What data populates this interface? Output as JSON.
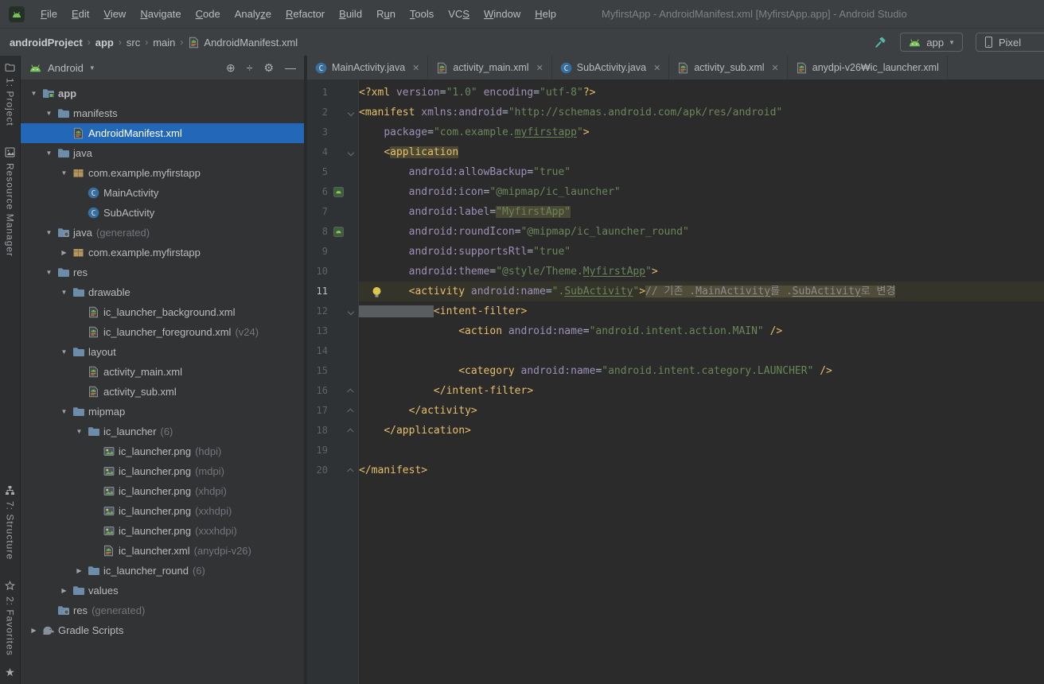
{
  "window": {
    "title": "MyfirstApp - AndroidManifest.xml [MyfirstApp.app] - Android Studio"
  },
  "menu": {
    "items": [
      {
        "label": "File",
        "m": 0
      },
      {
        "label": "Edit",
        "m": 0
      },
      {
        "label": "View",
        "m": 0
      },
      {
        "label": "Navigate",
        "m": 0
      },
      {
        "label": "Code",
        "m": 0
      },
      {
        "label": "Analyze",
        "m": 5
      },
      {
        "label": "Refactor",
        "m": 0
      },
      {
        "label": "Build",
        "m": 0
      },
      {
        "label": "Run",
        "m": 1
      },
      {
        "label": "Tools",
        "m": 0
      },
      {
        "label": "VCS",
        "m": 2
      },
      {
        "label": "Window",
        "m": 0
      },
      {
        "label": "Help",
        "m": 0
      }
    ]
  },
  "breadcrumbs": {
    "items": [
      {
        "label": "androidProject",
        "bold": true
      },
      {
        "label": "app",
        "bold": true
      },
      {
        "label": "src"
      },
      {
        "label": "main"
      },
      {
        "label": "AndroidManifest.xml",
        "icon": "android-xml"
      }
    ],
    "actions": {
      "build_icon": "hammer-icon",
      "run_config": {
        "icon": "android-head-icon",
        "label": "app"
      },
      "device": {
        "icon": "device-icon",
        "label": "Pixel"
      }
    }
  },
  "tool_stripe": {
    "top": [
      {
        "label": "1: Project",
        "icon": "project-tool-icon"
      },
      {
        "label": "Resource Manager",
        "icon": "resource-manager-icon"
      }
    ],
    "bottom": [
      {
        "label": "7: Structure",
        "icon": "structure-tool-icon"
      },
      {
        "label": "2: Favorites",
        "icon": "favorites-tool-icon"
      }
    ]
  },
  "project_panel": {
    "view_selector": "Android",
    "toolbar_icons": [
      "locate-icon",
      "collapse-all-icon",
      "settings-icon",
      "hide-icon"
    ],
    "tree": [
      {
        "label": "app",
        "icon": "folder-app",
        "indent": 0,
        "chev": "open",
        "bold": true
      },
      {
        "label": "manifests",
        "icon": "folder",
        "indent": 1,
        "chev": "open"
      },
      {
        "label": "AndroidManifest.xml",
        "icon": "android-xml",
        "indent": 2,
        "selected": true
      },
      {
        "label": "java",
        "icon": "folder",
        "indent": 1,
        "chev": "open"
      },
      {
        "label": "com.example.myfirstapp",
        "icon": "package",
        "indent": 2,
        "chev": "open"
      },
      {
        "label": "MainActivity",
        "icon": "java-class",
        "indent": 3
      },
      {
        "label": "SubActivity",
        "icon": "java-class",
        "indent": 3
      },
      {
        "label": "java",
        "meta": "(generated)",
        "icon": "folder-gen",
        "indent": 1,
        "chev": "open"
      },
      {
        "label": "com.example.myfirstapp",
        "icon": "package",
        "indent": 2,
        "chev": "closed"
      },
      {
        "label": "res",
        "icon": "folder",
        "indent": 1,
        "chev": "open"
      },
      {
        "label": "drawable",
        "icon": "folder",
        "indent": 2,
        "chev": "open"
      },
      {
        "label": "ic_launcher_background.xml",
        "icon": "android-xml",
        "indent": 3
      },
      {
        "label": "ic_launcher_foreground.xml",
        "meta": "(v24)",
        "icon": "android-xml",
        "indent": 3
      },
      {
        "label": "layout",
        "icon": "folder",
        "indent": 2,
        "chev": "open"
      },
      {
        "label": "activity_main.xml",
        "icon": "android-xml",
        "indent": 3
      },
      {
        "label": "activity_sub.xml",
        "icon": "android-xml",
        "indent": 3
      },
      {
        "label": "mipmap",
        "icon": "folder",
        "indent": 2,
        "chev": "open"
      },
      {
        "label": "ic_launcher",
        "meta": "(6)",
        "icon": "folder",
        "indent": 3,
        "chev": "open"
      },
      {
        "label": "ic_launcher.png",
        "meta": "(hdpi)",
        "icon": "image-file",
        "indent": 4
      },
      {
        "label": "ic_launcher.png",
        "meta": "(mdpi)",
        "icon": "image-file",
        "indent": 4
      },
      {
        "label": "ic_launcher.png",
        "meta": "(xhdpi)",
        "icon": "image-file",
        "indent": 4
      },
      {
        "label": "ic_launcher.png",
        "meta": "(xxhdpi)",
        "icon": "image-file",
        "indent": 4
      },
      {
        "label": "ic_launcher.png",
        "meta": "(xxxhdpi)",
        "icon": "image-file",
        "indent": 4
      },
      {
        "label": "ic_launcher.xml",
        "meta": "(anydpi-v26)",
        "icon": "android-xml",
        "indent": 4
      },
      {
        "label": "ic_launcher_round",
        "meta": "(6)",
        "icon": "folder",
        "indent": 3,
        "chev": "closed"
      },
      {
        "label": "values",
        "icon": "folder",
        "indent": 2,
        "chev": "closed"
      },
      {
        "label": "res",
        "meta": "(generated)",
        "icon": "folder-gen",
        "indent": 1
      },
      {
        "label": "Gradle Scripts",
        "icon": "gradle",
        "indent": 0,
        "chev": "closed"
      }
    ]
  },
  "editor": {
    "tabs": [
      {
        "label": "MainActivity.java",
        "icon": "java-class",
        "close": true
      },
      {
        "label": "activity_main.xml",
        "icon": "android-xml",
        "close": true
      },
      {
        "label": "SubActivity.java",
        "icon": "java-class",
        "close": true
      },
      {
        "label": "activity_sub.xml",
        "icon": "android-xml",
        "close": true
      },
      {
        "label": "anydpi-v26₩ic_launcher.xml",
        "icon": "android-xml",
        "close": false
      }
    ],
    "code": {
      "lines": [
        {
          "n": 1,
          "seg": [
            {
              "t": "<?xml ",
              "c": "t"
            },
            {
              "t": "version",
              "c": "a"
            },
            {
              "t": "=",
              "c": "p"
            },
            {
              "t": "\"1.0\"",
              "c": "s"
            },
            {
              "t": " ",
              "c": "p"
            },
            {
              "t": "encoding",
              "c": "a"
            },
            {
              "t": "=",
              "c": "p"
            },
            {
              "t": "\"utf-8\"",
              "c": "s"
            },
            {
              "t": "?>",
              "c": "t"
            }
          ]
        },
        {
          "n": 2,
          "fold": "down",
          "seg": [
            {
              "t": "<manifest ",
              "c": "t"
            },
            {
              "t": "xmlns:android",
              "c": "a"
            },
            {
              "t": "=",
              "c": "p"
            },
            {
              "t": "\"http://schemas.android.com/apk/res/android\"",
              "c": "s"
            }
          ]
        },
        {
          "n": 3,
          "seg": [
            {
              "t": "    ",
              "c": "p"
            },
            {
              "t": "package",
              "c": "a"
            },
            {
              "t": "=",
              "c": "p"
            },
            {
              "t": "\"com.example.",
              "c": "s"
            },
            {
              "t": "myfirstapp",
              "c": "s",
              "u": 1
            },
            {
              "t": "\"",
              "c": "s"
            },
            {
              "t": ">",
              "c": "t"
            }
          ]
        },
        {
          "n": 4,
          "fold": "down",
          "seg": [
            {
              "t": "    ",
              "c": "p"
            },
            {
              "t": "<",
              "c": "t"
            },
            {
              "t": "application",
              "c": "t",
              "h": "hl"
            }
          ]
        },
        {
          "n": 5,
          "seg": [
            {
              "t": "        ",
              "c": "p"
            },
            {
              "t": "android:allowBackup",
              "c": "a"
            },
            {
              "t": "=",
              "c": "p"
            },
            {
              "t": "\"true\"",
              "c": "s"
            }
          ]
        },
        {
          "n": 6,
          "icon": "image-preview",
          "seg": [
            {
              "t": "        ",
              "c": "p"
            },
            {
              "t": "android:icon",
              "c": "a"
            },
            {
              "t": "=",
              "c": "p"
            },
            {
              "t": "\"@mipmap/ic_launcher\"",
              "c": "s"
            }
          ]
        },
        {
          "n": 7,
          "seg": [
            {
              "t": "        ",
              "c": "p"
            },
            {
              "t": "android:label",
              "c": "a"
            },
            {
              "t": "=",
              "c": "p"
            },
            {
              "t": "\"MyfirstApp\"",
              "c": "s",
              "h": "hl"
            }
          ]
        },
        {
          "n": 8,
          "icon": "image-preview",
          "seg": [
            {
              "t": "        ",
              "c": "p"
            },
            {
              "t": "android:roundIcon",
              "c": "a"
            },
            {
              "t": "=",
              "c": "p"
            },
            {
              "t": "\"@mipmap/ic_launcher_round\"",
              "c": "s"
            }
          ]
        },
        {
          "n": 9,
          "seg": [
            {
              "t": "        ",
              "c": "p"
            },
            {
              "t": "android:supportsRtl",
              "c": "a"
            },
            {
              "t": "=",
              "c": "p"
            },
            {
              "t": "\"true\"",
              "c": "s"
            }
          ]
        },
        {
          "n": 10,
          "seg": [
            {
              "t": "        ",
              "c": "p"
            },
            {
              "t": "android:theme",
              "c": "a"
            },
            {
              "t": "=",
              "c": "p"
            },
            {
              "t": "\"@style/Theme.",
              "c": "s"
            },
            {
              "t": "MyfirstApp",
              "c": "s",
              "u": 1
            },
            {
              "t": "\"",
              "c": "s"
            },
            {
              "t": ">",
              "c": "t"
            }
          ]
        },
        {
          "n": 11,
          "caret": true,
          "bulb": true,
          "seg": [
            {
              "t": "        ",
              "c": "p"
            },
            {
              "t": "<activity ",
              "c": "t"
            },
            {
              "t": "android:name",
              "c": "a"
            },
            {
              "t": "=",
              "c": "p"
            },
            {
              "t": "\".",
              "c": "s"
            },
            {
              "t": "SubActivity",
              "c": "s",
              "u": 1
            },
            {
              "t": "\"",
              "c": "s"
            },
            {
              "t": ">",
              "c": "t"
            },
            {
              "t": "// 기존 .",
              "c": "c",
              "h": "cb"
            },
            {
              "t": "MainActivity",
              "c": "c",
              "h": "cb",
              "u": 1
            },
            {
              "t": "를 .",
              "c": "c",
              "h": "cb"
            },
            {
              "t": "SubActivity",
              "c": "c",
              "h": "cb",
              "u": 1
            },
            {
              "t": "로 변경",
              "c": "c",
              "h": "cb"
            }
          ]
        },
        {
          "n": 12,
          "fold": "down",
          "seg": [
            {
              "t": "            ",
              "c": "p",
              "h": "sb"
            },
            {
              "t": "<intent-filter>",
              "c": "t"
            }
          ]
        },
        {
          "n": 13,
          "seg": [
            {
              "t": "                ",
              "c": "p"
            },
            {
              "t": "<action ",
              "c": "t"
            },
            {
              "t": "android:name",
              "c": "a"
            },
            {
              "t": "=",
              "c": "p"
            },
            {
              "t": "\"android.intent.action.MAIN\"",
              "c": "s"
            },
            {
              "t": " ",
              "c": "p"
            },
            {
              "t": "/>",
              "c": "t"
            }
          ]
        },
        {
          "n": 14,
          "seg": []
        },
        {
          "n": 15,
          "seg": [
            {
              "t": "                ",
              "c": "p"
            },
            {
              "t": "<category ",
              "c": "t"
            },
            {
              "t": "android:name",
              "c": "a"
            },
            {
              "t": "=",
              "c": "p"
            },
            {
              "t": "\"android.intent.category.LAUNCHER\"",
              "c": "s"
            },
            {
              "t": " ",
              "c": "p"
            },
            {
              "t": "/>",
              "c": "t"
            }
          ]
        },
        {
          "n": 16,
          "fold": "up",
          "seg": [
            {
              "t": "            ",
              "c": "p"
            },
            {
              "t": "</intent-filter>",
              "c": "t"
            }
          ]
        },
        {
          "n": 17,
          "fold": "up",
          "seg": [
            {
              "t": "        ",
              "c": "p"
            },
            {
              "t": "</activity>",
              "c": "t"
            }
          ]
        },
        {
          "n": 18,
          "fold": "up",
          "seg": [
            {
              "t": "    ",
              "c": "p"
            },
            {
              "t": "</application>",
              "c": "t"
            }
          ]
        },
        {
          "n": 19,
          "seg": []
        },
        {
          "n": 20,
          "fold": "up",
          "seg": [
            {
              "t": "</manifest>",
              "c": "t"
            }
          ]
        }
      ]
    }
  },
  "colors": {
    "selection_blue": "#2368b8",
    "tag": "#e8bf6a",
    "attribute": "#9e90b8",
    "string": "#6a8759",
    "comment": "#8c8c8c",
    "editor_bg": "#2b2b2b",
    "panel_bg": "#313335",
    "bar_bg": "#3c4043"
  }
}
